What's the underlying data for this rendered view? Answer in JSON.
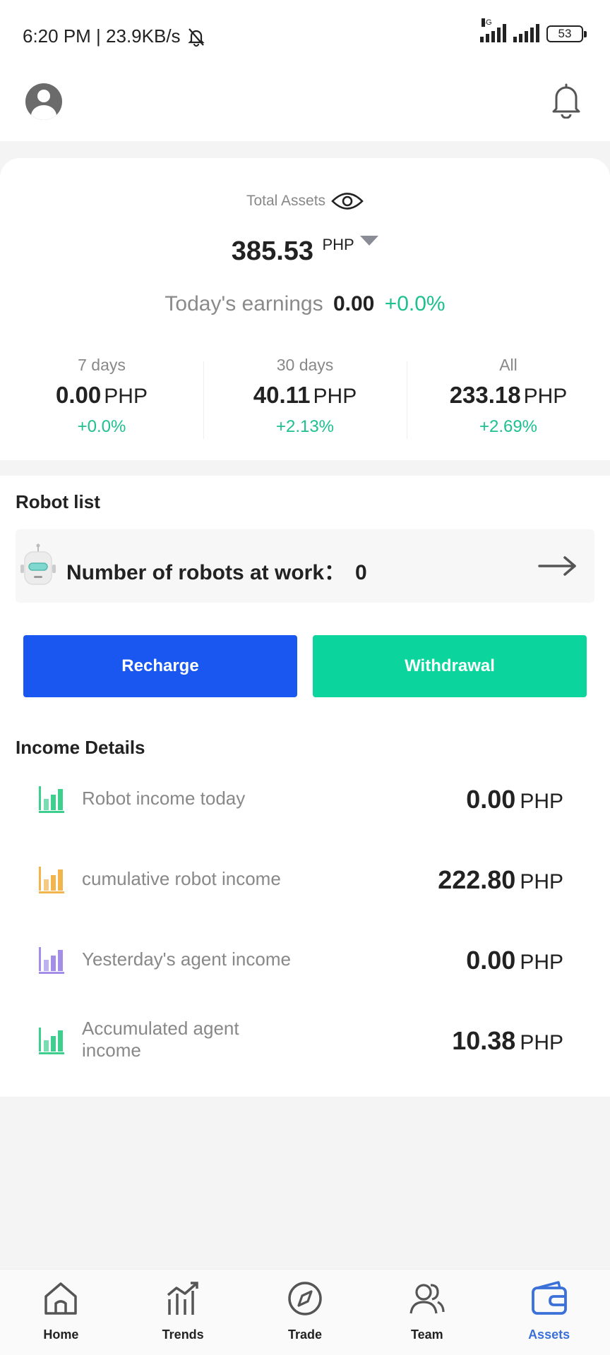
{
  "status_bar": {
    "time_speed": "6:20 PM | 23.9KB/s",
    "network_label": "4G",
    "battery": "53"
  },
  "header": {
    "avatar_icon": "user-avatar-icon",
    "bell_icon": "bell-icon"
  },
  "assets": {
    "total_label": "Total Assets",
    "total_value": "385.53",
    "currency": "PHP",
    "today_label": "Today's earnings",
    "today_value": "0.00",
    "today_pct": "+0.0%",
    "stats": [
      {
        "label": "7 days",
        "value": "0.00",
        "currency": "PHP",
        "pct": "+0.0%"
      },
      {
        "label": "30 days",
        "value": "40.11",
        "currency": "PHP",
        "pct": "+2.13%"
      },
      {
        "label": "All",
        "value": "233.18",
        "currency": "PHP",
        "pct": "+2.69%"
      }
    ]
  },
  "robots": {
    "title": "Robot list",
    "label": "Number of robots at work：",
    "count": "0"
  },
  "actions": {
    "recharge": "Recharge",
    "withdrawal": "Withdrawal"
  },
  "income": {
    "title": "Income Details",
    "rows": [
      {
        "label": "Robot income today",
        "value": "0.00",
        "currency": "PHP",
        "color": "#3ecf8e"
      },
      {
        "label": "cumulative robot income",
        "value": "222.80",
        "currency": "PHP",
        "color": "#f2b44c"
      },
      {
        "label": "Yesterday's agent income",
        "value": "0.00",
        "currency": "PHP",
        "color": "#a48ee8"
      },
      {
        "label": "Accumulated agent income",
        "value": "10.38",
        "currency": "PHP",
        "color": "#3ecf8e"
      }
    ]
  },
  "nav": {
    "items": [
      {
        "label": "Home",
        "icon": "home-icon"
      },
      {
        "label": "Trends",
        "icon": "trends-icon"
      },
      {
        "label": "Trade",
        "icon": "compass-icon"
      },
      {
        "label": "Team",
        "icon": "team-icon"
      },
      {
        "label": "Assets",
        "icon": "wallet-icon",
        "active": true
      }
    ]
  },
  "colors": {
    "accent_green": "#1ec08f",
    "recharge_blue": "#1957f0",
    "withdraw_green": "#0bd59c",
    "nav_active": "#3a70d8"
  }
}
